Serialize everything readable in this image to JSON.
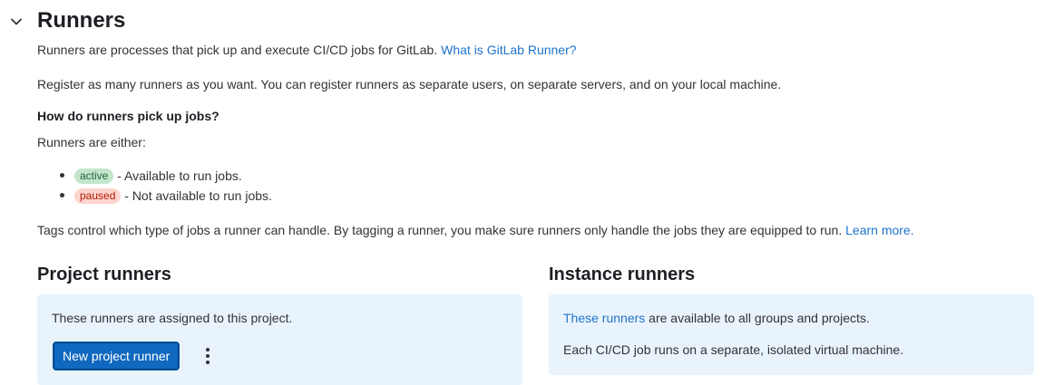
{
  "section": {
    "title": "Runners",
    "description": "Runners are processes that pick up and execute CI/CD jobs for GitLab. ",
    "description_link": "What is GitLab Runner?",
    "register_text": "Register as many runners as you want. You can register runners as separate users, on separate servers, and on your local machine.",
    "howto_heading": "How do runners pick up jobs?",
    "either_text": "Runners are either:",
    "states": [
      {
        "badge": "active",
        "text": " - Available to run jobs."
      },
      {
        "badge": "paused",
        "text": " - Not available to run jobs."
      }
    ],
    "tags_text": "Tags control which type of jobs a runner can handle. By tagging a runner, you make sure runners only handle the jobs they are equipped to run. ",
    "tags_link": "Learn more."
  },
  "project_runners": {
    "title": "Project runners",
    "text": "These runners are assigned to this project.",
    "button_label": "New project runner",
    "more_icon": "ellipsis-v-icon"
  },
  "instance_runners": {
    "title": "Instance runners",
    "link": "These runners",
    "text": " are available to all groups and projects.",
    "note": "Each CI/CD job runs on a separate, isolated virtual machine."
  },
  "colors": {
    "link": "#1f75cb",
    "button": "#1068bf",
    "panel": "#e9f3fc",
    "badge_active_bg": "#c3e6cd",
    "badge_paused_bg": "#fdd4cd"
  }
}
